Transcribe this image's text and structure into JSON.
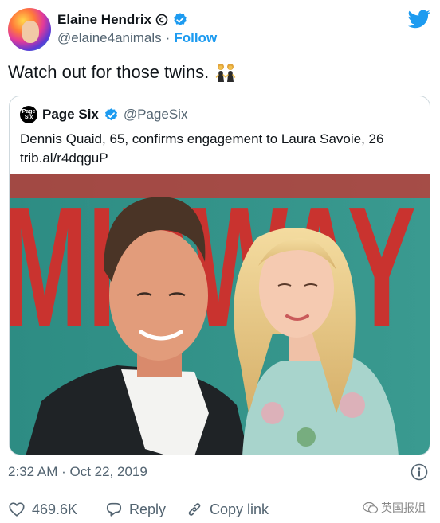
{
  "author": {
    "display_name": "Elaine Hendrix",
    "handle": "@elaine4animals",
    "separator": "·",
    "follow_label": "Follow"
  },
  "tweet": {
    "text": "Watch out for those twins.",
    "emoji": "two-women-twins-emoji"
  },
  "quoted": {
    "logo_text": "Page Six",
    "display_name": "Page Six",
    "handle": "@PageSix",
    "text_line1": "Dennis Quaid, 65, confirms engagement to Laura Savoie, 26",
    "text_line2": "trib.al/r4dqguP",
    "backdrop_text": "MIDWAY"
  },
  "meta": {
    "timestamp": "2:32 AM · Oct 22, 2019"
  },
  "actions": {
    "likes": "469.6K",
    "reply_label": "Reply",
    "copy_link_label": "Copy link"
  },
  "watermark": {
    "text": "英国报姐"
  },
  "colors": {
    "accent": "#1d9bf0",
    "backdrop_teal": "#2f8f86",
    "backdrop_red": "#c9332f"
  }
}
